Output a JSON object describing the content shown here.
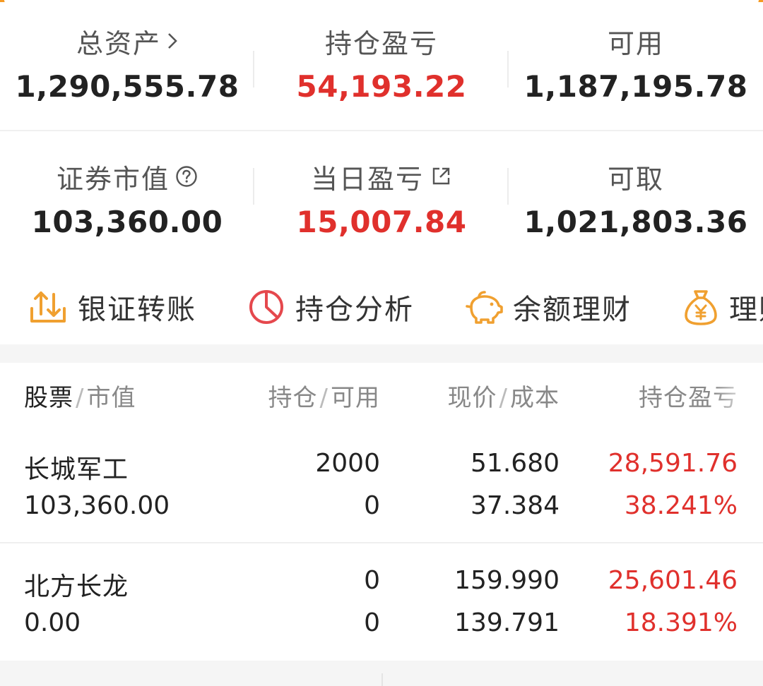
{
  "summary": {
    "total_assets": {
      "label": "总资产",
      "value": "1,290,555.78"
    },
    "position_pnl": {
      "label": "持仓盈亏",
      "value": "54,193.22"
    },
    "available": {
      "label": "可用",
      "value": "1,187,195.78"
    },
    "securities_value": {
      "label": "证券市值",
      "value": "103,360.00"
    },
    "daily_pnl": {
      "label": "当日盈亏",
      "value": "15,007.84"
    },
    "withdrawable": {
      "label": "可取",
      "value": "1,021,803.36"
    }
  },
  "shortcuts": [
    {
      "label": "银证转账",
      "icon": "transfer-icon"
    },
    {
      "label": "持仓分析",
      "icon": "pie-chart-icon"
    },
    {
      "label": "余额理财",
      "icon": "piggy-bank-icon"
    },
    {
      "label": "理财",
      "icon": "money-bag-icon"
    }
  ],
  "table": {
    "headers": {
      "stock": {
        "main": "股票",
        "sub": "市值"
      },
      "position": {
        "main": "持仓",
        "sub": "可用"
      },
      "price": {
        "main": "现价",
        "sub": "成本"
      },
      "pnl": "持仓盈亏"
    },
    "rows": [
      {
        "name": "长城军工",
        "market_value": "103,360.00",
        "position": "2000",
        "available": "0",
        "price": "51.680",
        "cost": "37.384",
        "pnl": "28,591.76",
        "pnl_pct": "38.241%"
      },
      {
        "name": "北方长龙",
        "market_value": "0.00",
        "position": "0",
        "available": "0",
        "price": "159.990",
        "cost": "139.791",
        "pnl": "25,601.46",
        "pnl_pct": "18.391%"
      }
    ]
  },
  "colors": {
    "profit_red": "#e0302c",
    "icon_orange": "#f0a030",
    "icon_red": "#e5484d"
  }
}
